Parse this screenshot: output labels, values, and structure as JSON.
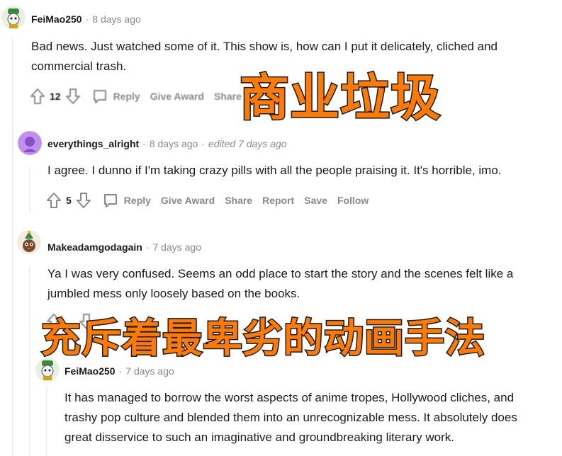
{
  "comments": [
    {
      "user": "FeiMao250",
      "time": "8 days ago",
      "edited": "",
      "body_lines": [
        "Bad news. Just watched some of it. This show is, how can I put it delicately, cliched and",
        "commercial trash."
      ],
      "votes": "12",
      "actions": [
        "Reply",
        "Give Award",
        "Share"
      ]
    },
    {
      "user": "everythings_alright",
      "time": "8 days ago",
      "edited": "edited 7 days ago",
      "body_lines": [
        "I agree. I dunno if I'm taking crazy pills with all the people praising it. It's horrible, imo."
      ],
      "votes": "5",
      "actions": [
        "Reply",
        "Give Award",
        "Share",
        "Report",
        "Save",
        "Follow"
      ]
    },
    {
      "user": "Makeadamgodagain",
      "time": "7 days ago",
      "edited": "",
      "body_lines": [
        "Ya I was very confused. Seems an odd place to start the story and the scenes felt like a",
        "jumbled mess only loosely based on the books."
      ]
    },
    {
      "user": "FeiMao250",
      "time": "7 days ago",
      "edited": "",
      "body_lines": [
        "It has managed to borrow the worst aspects of anime tropes, Hollywood cliches, and",
        "trashy pop culture and blended them into an unrecognizable mess. It absolutely does",
        "great disservice to such an imaginative and groundbreaking literary work."
      ]
    }
  ],
  "overlays": {
    "caption_top": "商业垃圾",
    "caption_bottom": "充斥着最卑劣的动画手法"
  },
  "icons": {
    "upvote": "upvote-arrow-icon",
    "downvote": "downvote-arrow-icon",
    "reply": "speech-bubble-icon"
  },
  "colors": {
    "overlay_text": "#ff7a00",
    "meta_gray": "#878a8c",
    "avatar_purple": "#c08ff0"
  }
}
